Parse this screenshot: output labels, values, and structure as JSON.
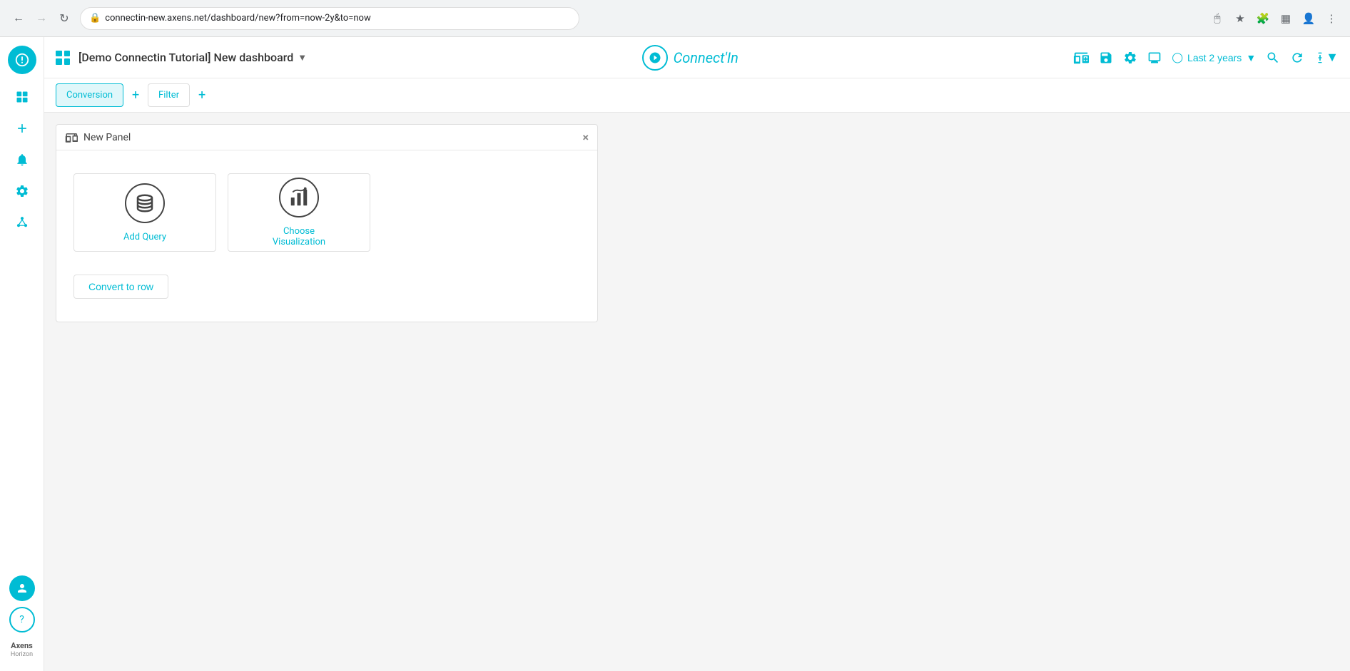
{
  "browser": {
    "url": "connectin-new.axens.net/dashboard/new?from=now-2y&to=now",
    "back_disabled": false,
    "forward_disabled": true
  },
  "header": {
    "dashboard_title": "[Demo Connectin Tutorial] New dashboard",
    "logo_text": "Connect'In",
    "time_label": "Last 2 years",
    "actions": {
      "add_panel": "add-panel",
      "save": "save",
      "settings": "settings",
      "display": "display",
      "search": "search",
      "refresh": "refresh",
      "more": "more"
    }
  },
  "tabs": [
    {
      "label": "Conversion",
      "active": true
    },
    {
      "label": "Filter",
      "active": false
    }
  ],
  "panel": {
    "title": "New Panel",
    "close_label": "×",
    "options": [
      {
        "label": "Add Query",
        "icon": "database"
      },
      {
        "label": "Choose Visualization",
        "icon": "chart"
      }
    ],
    "convert_btn_label": "Convert to row"
  },
  "sidebar": {
    "items": [
      {
        "label": "dashboard",
        "icon": "⊞"
      },
      {
        "label": "add",
        "icon": "+"
      },
      {
        "label": "alerts",
        "icon": "🔔"
      },
      {
        "label": "settings",
        "icon": "⚙"
      },
      {
        "label": "connections",
        "icon": "⧖"
      }
    ],
    "avatar_text": "👤",
    "help_text": "?",
    "brand_name": "Axens",
    "brand_subtitle": "Horizon"
  }
}
